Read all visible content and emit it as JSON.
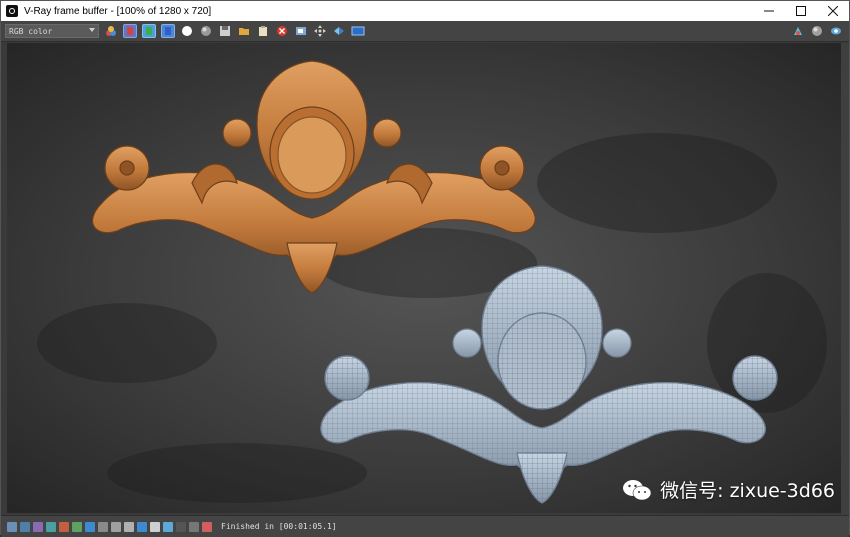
{
  "window": {
    "title": "V-Ray frame buffer - [100% of 1280 x 720]",
    "controls": {
      "minimize": "minimize",
      "maximize": "maximize",
      "close": "close"
    }
  },
  "toolbar": {
    "channel_value": "RGB color",
    "icons_left": [
      "spheres-icon",
      "red-channel-icon",
      "green-channel-icon",
      "blue-channel-icon",
      "alpha-white-icon",
      "mono-icon",
      "save-icon",
      "open-icon",
      "clear-icon",
      "stop-icon",
      "region-render-icon",
      "track-mouse-icon",
      "compare-icon",
      "link-icon"
    ],
    "icons_right": [
      "render-icon",
      "sphere-icon",
      "settings-icon"
    ]
  },
  "colors": {
    "red_channel": "#5b79c9",
    "green_channel": "#4fa0d8",
    "blue_channel": "#4a88d4",
    "stop": "#d63a2c",
    "wood": "#c98142",
    "wireframe": "#a8b9cc"
  },
  "statusbar": {
    "text": "Finished in [00:01:05.1]"
  },
  "watermark": {
    "text": "微信号: zixue-3d66"
  }
}
